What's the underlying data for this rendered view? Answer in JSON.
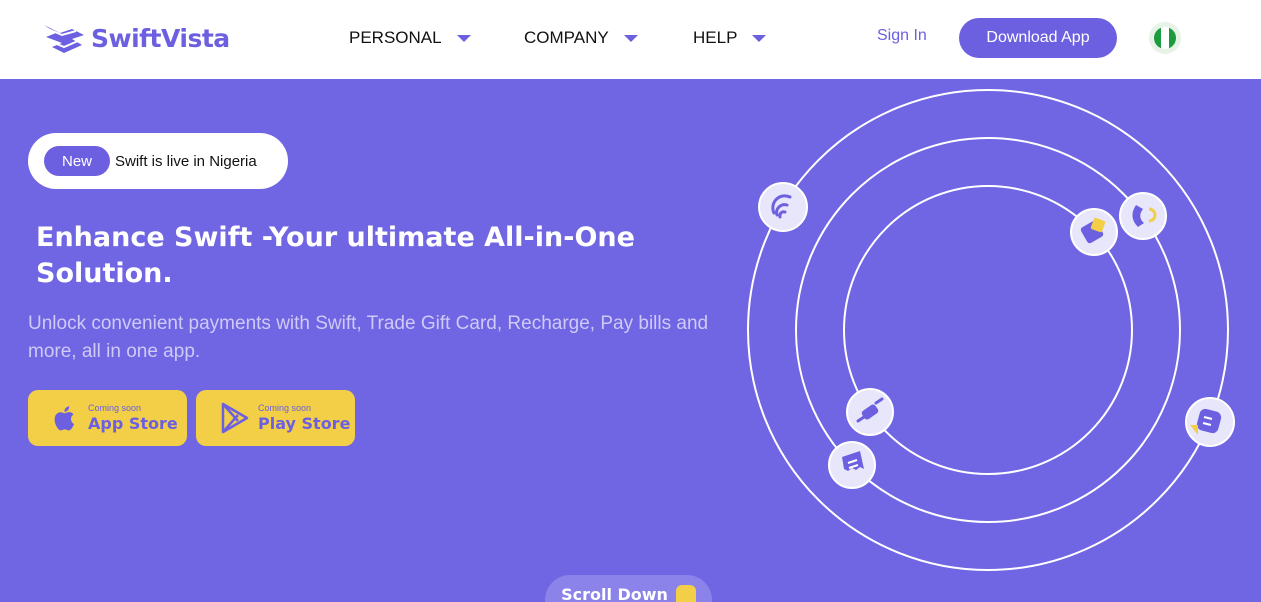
{
  "brand": {
    "name": "SwiftVista",
    "color": "#6c60e0"
  },
  "nav": {
    "items": [
      {
        "label": "PERSONAL"
      },
      {
        "label": "COMPANY"
      },
      {
        "label": "HELP"
      }
    ],
    "sign_in": "Sign In",
    "download": "Download App",
    "country_flag": "nigeria-flag-icon"
  },
  "hero": {
    "badge_tag": "New",
    "badge_text": "Swift is live in Nigeria",
    "headline": "Enhance Swift -Your ultimate All-in-One Solution.",
    "subtext": "Unlock convenient payments with Swift, Trade Gift Card, Recharge, Pay bills and more, all in one app.",
    "stores": [
      {
        "soon": "Coming soon",
        "name": "App Store",
        "icon": "apple-icon"
      },
      {
        "soon": "Coming soon",
        "name": "Play Store",
        "icon": "play-store-icon"
      }
    ],
    "scroll": "Scroll Down"
  },
  "colors": {
    "background": "#7065e3",
    "accent": "#f2cf47",
    "white": "#ffffff"
  },
  "orbit_icons": [
    "wifi-icon",
    "gift-card-icon",
    "phone-call-icon",
    "power-plug-icon",
    "receipt-icon",
    "chat-bubble-icon"
  ]
}
